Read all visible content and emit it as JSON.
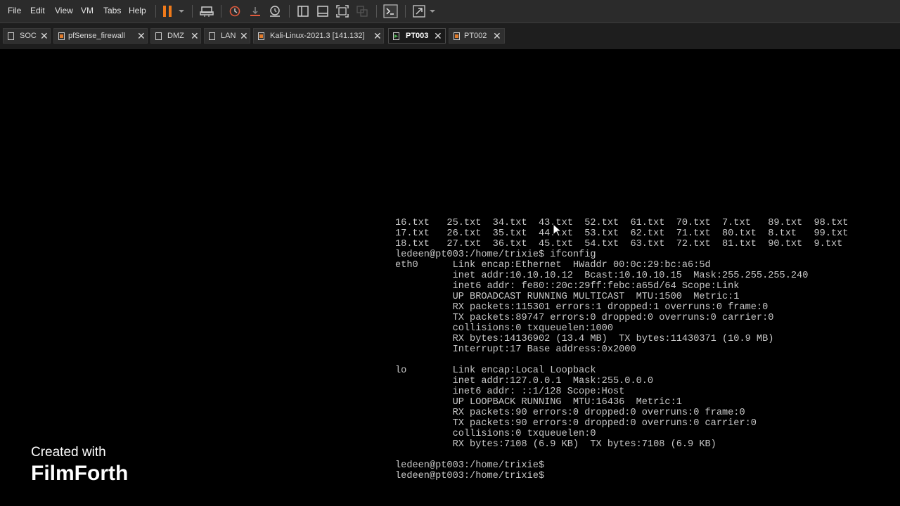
{
  "menu": [
    "File",
    "Edit",
    "View",
    "VM",
    "Tabs",
    "Help"
  ],
  "tabs": [
    {
      "label": "SOC",
      "active": false
    },
    {
      "label": "pfSense_firewall",
      "active": false
    },
    {
      "label": "DMZ",
      "active": false
    },
    {
      "label": "LAN",
      "active": false
    },
    {
      "label": "Kali-Linux-2021.3 [141.132]",
      "active": false
    },
    {
      "label": "PT003",
      "active": true
    },
    {
      "label": "PT002",
      "active": false
    }
  ],
  "toolbar_icons": [
    "pause-icon",
    "dropdown-arrow-icon",
    "send-ctrl-alt-del-icon",
    "snapshot-icon",
    "revert-snapshot-icon",
    "snapshot-manager-icon",
    "library-view-icon",
    "thumbnail-bar-icon",
    "full-screen-icon",
    "unity-icon",
    "console-view-icon",
    "stretch-view-icon",
    "dropdown-arrow-icon"
  ],
  "terminal": {
    "lines": [
      "16.txt   25.txt  34.txt  43.txt  52.txt  61.txt  70.txt  7.txt   89.txt  98.txt",
      "17.txt   26.txt  35.txt  44.txt  53.txt  62.txt  71.txt  80.txt  8.txt   99.txt",
      "18.txt   27.txt  36.txt  45.txt  54.txt  63.txt  72.txt  81.txt  90.txt  9.txt",
      "ledeen@pt003:/home/trixie$ ifconfig",
      "eth0      Link encap:Ethernet  HWaddr 00:0c:29:bc:a6:5d",
      "          inet addr:10.10.10.12  Bcast:10.10.10.15  Mask:255.255.255.240",
      "          inet6 addr: fe80::20c:29ff:febc:a65d/64 Scope:Link",
      "          UP BROADCAST RUNNING MULTICAST  MTU:1500  Metric:1",
      "          RX packets:115301 errors:1 dropped:1 overruns:0 frame:0",
      "          TX packets:89747 errors:0 dropped:0 overruns:0 carrier:0",
      "          collisions:0 txqueuelen:1000",
      "          RX bytes:14136902 (13.4 MB)  TX bytes:11430371 (10.9 MB)",
      "          Interrupt:17 Base address:0x2000",
      "",
      "lo        Link encap:Local Loopback",
      "          inet addr:127.0.0.1  Mask:255.0.0.0",
      "          inet6 addr: ::1/128 Scope:Host",
      "          UP LOOPBACK RUNNING  MTU:16436  Metric:1",
      "          RX packets:90 errors:0 dropped:0 overruns:0 frame:0",
      "          TX packets:90 errors:0 dropped:0 overruns:0 carrier:0",
      "          collisions:0 txqueuelen:0",
      "          RX bytes:7108 (6.9 KB)  TX bytes:7108 (6.9 KB)",
      "",
      "ledeen@pt003:/home/trixie$",
      "ledeen@pt003:/home/trixie$"
    ]
  },
  "watermark": {
    "line1": "Created with",
    "line2": "FilmForth"
  },
  "colors": {
    "pause": "#f07a1a",
    "menubar": "#2b2b2b",
    "tabbar": "#1e1e1e",
    "terminal_text": "#c8c8c8"
  }
}
